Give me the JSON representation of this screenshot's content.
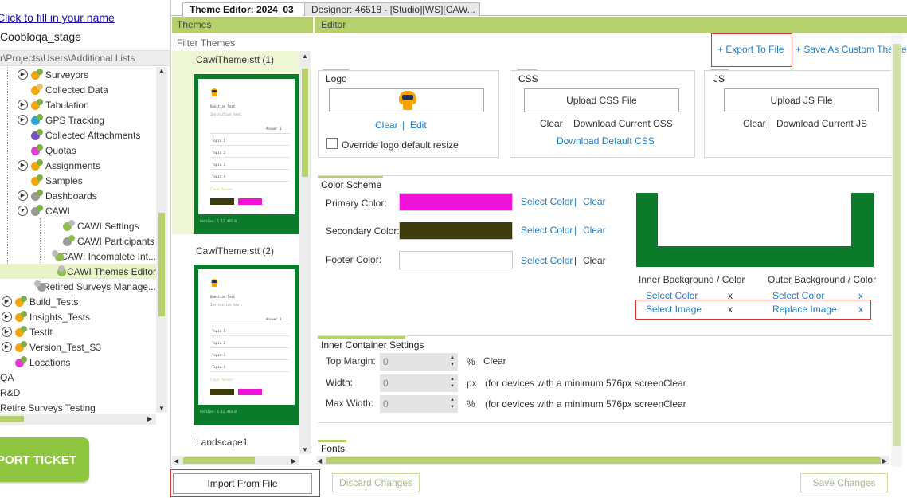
{
  "user": {
    "fill_name_link": "Click to fill in your name",
    "stage": "Coobloqa_stage"
  },
  "nav_path": "r\\Projects\\Users\\Additional Lists",
  "tree": [
    {
      "label": "Surveyors",
      "expander": true
    },
    {
      "label": "Collected Data",
      "expander": false
    },
    {
      "label": "Tabulation",
      "expander": true
    },
    {
      "label": "GPS Tracking",
      "expander": true
    },
    {
      "label": "Collected Attachments",
      "expander": false
    },
    {
      "label": "Quotas",
      "expander": false
    },
    {
      "label": "Assignments",
      "expander": true
    },
    {
      "label": "Samples",
      "expander": false
    },
    {
      "label": "Dashboards",
      "expander": true
    },
    {
      "label": "CAWI",
      "expander": true
    },
    {
      "label": "CAWI Settings",
      "expander": false
    },
    {
      "label": "CAWI Participants",
      "expander": false
    },
    {
      "label": "CAWI Incomplete Int...",
      "expander": false
    },
    {
      "label": "CAWI Themes Editor",
      "expander": false
    },
    {
      "label": "Retired Surveys Manage...",
      "expander": false
    },
    {
      "label": "Build_Tests",
      "expander": true
    },
    {
      "label": "Insights_Tests",
      "expander": true
    },
    {
      "label": "TestIt",
      "expander": true
    },
    {
      "label": "Version_Test_S3",
      "expander": true
    },
    {
      "label": "Locations",
      "expander": false
    },
    {
      "label": "QA",
      "expander": false
    },
    {
      "label": "R&D",
      "expander": false
    },
    {
      "label": "Retire Surveys Testing",
      "expander": false
    }
  ],
  "support_ticket_label": "PORT TICKET",
  "tabs": [
    {
      "label": "Theme Editor: 2024_03"
    },
    {
      "label": "Designer: 46518 - [Studio][WS][CAW..."
    }
  ],
  "themes": {
    "header": "Themes",
    "filter_placeholder": "Filter Themes",
    "items": [
      {
        "title": "CawiTheme.stt (1)"
      },
      {
        "title": "CawiTheme.stt (2)"
      },
      {
        "title": "Landscape1"
      }
    ],
    "preview": {
      "question": "Question Text",
      "instruction": "Instruction text.",
      "answer": "Answer 1",
      "topics": [
        "Topic 1",
        "Topic 2",
        "Topic 3",
        "Topic 4"
      ],
      "clear": "Clear Answer",
      "version": "Version: 1.12.493.0"
    },
    "import_label": "Import From File"
  },
  "editor": {
    "header": "Editor",
    "export_label": "+ Export To File",
    "save_custom_label": "+ Save As Custom Theme",
    "logo": {
      "title": "Logo",
      "clear": "Clear",
      "sep": "|",
      "edit": "Edit",
      "override": "Override logo default resize"
    },
    "css": {
      "title": "CSS",
      "upload": "Upload CSS File",
      "clear": "Clear",
      "sep": "|",
      "download_current": "Download Current CSS",
      "download_default": "Download Default CSS"
    },
    "js": {
      "title": "JS",
      "upload": "Upload JS File",
      "clear": "Clear",
      "sep": "|",
      "download_current": "Download Current JS"
    },
    "color_scheme": {
      "title": "Color Scheme",
      "primary_label": "Primary Color:",
      "secondary_label": "Secondary Color:",
      "footer_label": "Footer Color:",
      "primary_color": "#f013d9",
      "secondary_color": "#3d3b0a",
      "footer_color": "#ffffff",
      "select_color": "Select Color",
      "sep": "|",
      "clear": "Clear",
      "preview_outer_color": "#0b7a2a",
      "inner_bg_label": "Inner Background / Color",
      "outer_bg_label": "Outer Background / Color",
      "inner_select_color": "Select Color",
      "inner_select_image": "Select Image",
      "outer_select_color": "Select Color",
      "outer_replace_image": "Replace Image",
      "x": "x"
    },
    "inner_container": {
      "title": "Inner Container Settings",
      "rows": [
        {
          "label": "Top Margin:",
          "value": "0",
          "unit": "%",
          "note": "",
          "clear": "Clear"
        },
        {
          "label": "Width:",
          "value": "0",
          "unit": "px",
          "note": "(for devices with a minimum 576px screen",
          "clear": "Clear"
        },
        {
          "label": "Max Width:",
          "value": "0",
          "unit": "%",
          "note": "(for devices with a minimum 576px screen",
          "clear": "Clear"
        }
      ]
    },
    "fonts": {
      "title": "Fonts"
    },
    "discard_label": "Discard Changes",
    "save_label": "Save Changes"
  }
}
